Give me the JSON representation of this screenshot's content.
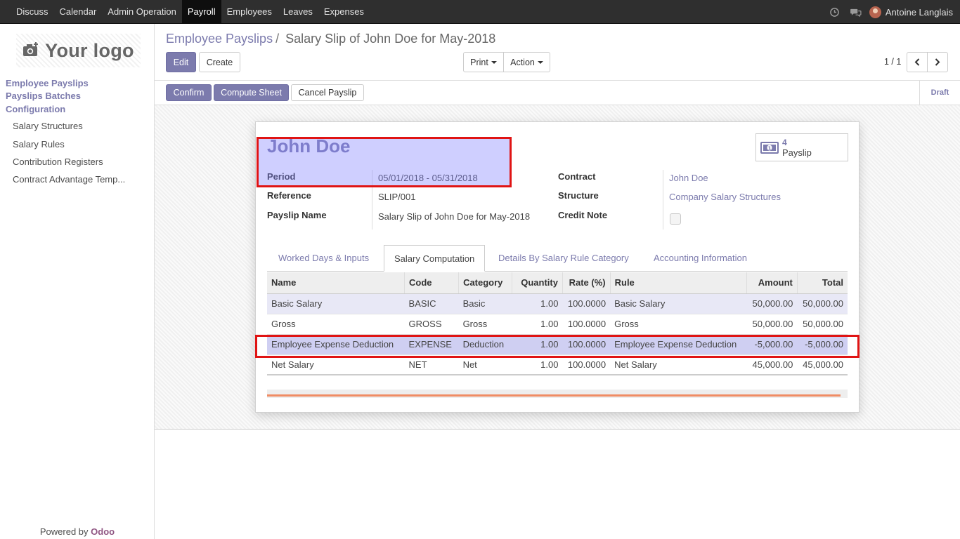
{
  "topbar": {
    "menu": [
      "Discuss",
      "Calendar",
      "Admin Operation",
      "Payroll",
      "Employees",
      "Leaves",
      "Expenses"
    ],
    "active_menu": "Payroll",
    "user": "Antoine Langlais",
    "icons": [
      "clock-icon",
      "chat-icon"
    ]
  },
  "sidebar": {
    "logo_text": "Your logo",
    "sections": [
      "Employee Payslips",
      "Payslips Batches",
      "Configuration"
    ],
    "config_items": [
      "Salary Structures",
      "Salary Rules",
      "Contribution Registers",
      "Contract Advantage Temp..."
    ],
    "powered_prefix": "Powered by",
    "powered_brand": "Odoo"
  },
  "breadcrumb": {
    "parent": "Employee Payslips",
    "separator": "/",
    "current": "Salary Slip of John Doe for May-2018"
  },
  "toolbar": {
    "edit": "Edit",
    "create": "Create",
    "print": "Print",
    "action": "Action",
    "pager": "1 / 1"
  },
  "statusbar": {
    "confirm": "Confirm",
    "compute": "Compute Sheet",
    "cancel": "Cancel Payslip",
    "state": "Draft"
  },
  "form": {
    "employee": "John Doe",
    "smart_button": {
      "count": "4",
      "label": "Payslip"
    },
    "fields": {
      "period_label": "Period",
      "period_value": "05/01/2018 - 05/31/2018",
      "reference_label": "Reference",
      "reference_value": "SLIP/001",
      "payslip_name_label": "Payslip Name",
      "payslip_name_value": "Salary Slip of John Doe for May-2018",
      "contract_label": "Contract",
      "contract_value": "John Doe",
      "structure_label": "Structure",
      "structure_value": "Company Salary Structures",
      "credit_note_label": "Credit Note",
      "credit_note_checked": false
    },
    "tabs": [
      "Worked Days & Inputs",
      "Salary Computation",
      "Details By Salary Rule Category",
      "Accounting Information"
    ],
    "active_tab": "Salary Computation"
  },
  "table": {
    "headers": [
      "Name",
      "Code",
      "Category",
      "Quantity",
      "Rate (%)",
      "Rule",
      "Amount",
      "Total"
    ],
    "rows": [
      {
        "name": "Basic Salary",
        "code": "BASIC",
        "category": "Basic",
        "quantity": "1.00",
        "rate": "100.0000",
        "rule": "Basic Salary",
        "amount": "50,000.00",
        "total": "50,000.00"
      },
      {
        "name": "Gross",
        "code": "GROSS",
        "category": "Gross",
        "quantity": "1.00",
        "rate": "100.0000",
        "rule": "Gross",
        "amount": "50,000.00",
        "total": "50,000.00"
      },
      {
        "name": "Employee Expense Deduction",
        "code": "EXPENSE",
        "category": "Deduction",
        "quantity": "1.00",
        "rate": "100.0000",
        "rule": "Employee Expense Deduction",
        "amount": "-5,000.00",
        "total": "-5,000.00"
      },
      {
        "name": "Net Salary",
        "code": "NET",
        "category": "Net",
        "quantity": "1.00",
        "rate": "100.0000",
        "rule": "Net Salary",
        "amount": "45,000.00",
        "total": "45,000.00"
      }
    ]
  },
  "colors": {
    "accent": "#7c7bad",
    "highlight_border": "#e01414",
    "topbar": "#2f2f2f"
  }
}
